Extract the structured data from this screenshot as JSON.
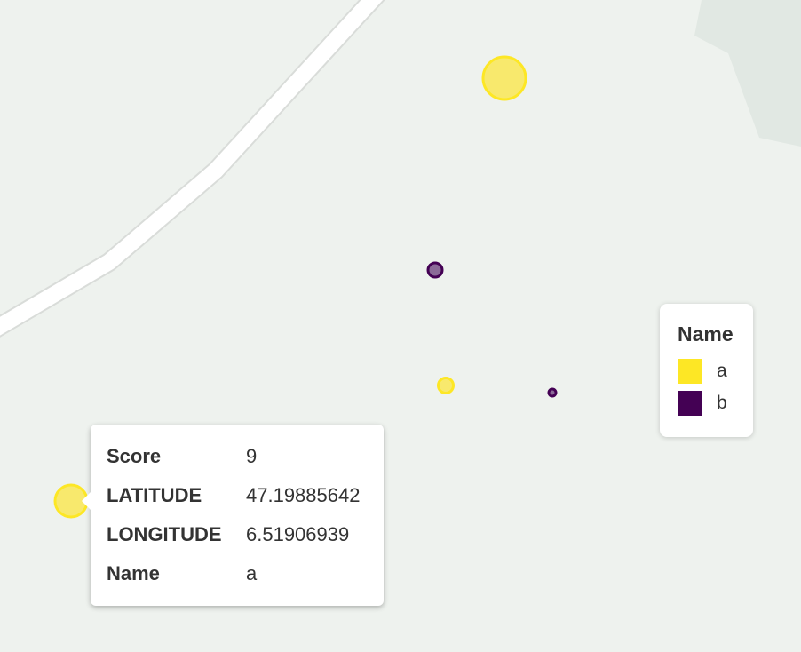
{
  "legend": {
    "title": "Name",
    "items": [
      {
        "label": "a",
        "color": "#fde725"
      },
      {
        "label": "b",
        "color": "#440154"
      }
    ]
  },
  "tooltip": {
    "rows": [
      {
        "key": "Score",
        "value": "9"
      },
      {
        "key": "LATITUDE",
        "value": "47.19885642"
      },
      {
        "key": "LONGITUDE",
        "value": "6.51906939"
      },
      {
        "key": "Name",
        "value": "a"
      }
    ]
  },
  "markers": [
    {
      "name": "a",
      "color": "#fde725"
    },
    {
      "name": "b",
      "color": "#440154"
    },
    {
      "name": "a",
      "color": "#fde725"
    },
    {
      "name": "b",
      "color": "#440154"
    },
    {
      "name": "a",
      "color": "#fde725"
    },
    {
      "name": "b",
      "color": "#440154"
    }
  ],
  "colors": {
    "land": "#eef2ee",
    "road": "#ffffff",
    "road_edge": "#d9dcd9",
    "park": "#e1e8e3"
  }
}
